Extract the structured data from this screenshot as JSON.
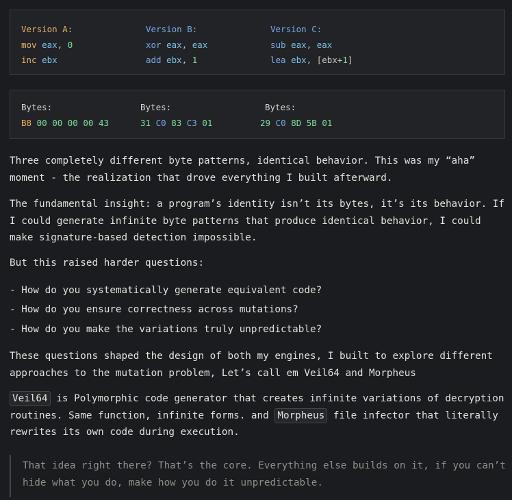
{
  "code_block_versions": {
    "version_a": {
      "header": "Version A:",
      "line1": {
        "op": "mov",
        "reg": "eax",
        "sep": ",",
        "val": "0"
      },
      "line2": {
        "op": "inc",
        "reg": "ebx"
      }
    },
    "version_b": {
      "header": "Version B:",
      "line1": {
        "op": "xor",
        "reg": "eax",
        "sep": ",",
        "val": "eax"
      },
      "line2": {
        "op": "add",
        "reg": "ebx",
        "sep": ",",
        "val": "1"
      }
    },
    "version_c": {
      "header": "Version C:",
      "line1": {
        "op": "sub",
        "reg": "eax",
        "sep": ",",
        "val": "eax"
      },
      "line2": {
        "op": "lea",
        "reg": "ebx",
        "sep": ",",
        "val_open": "[ebx",
        "val_plus": "+",
        "val_num": "1",
        "val_close": "]"
      }
    }
  },
  "code_block_bytes": {
    "col_a": {
      "label": "Bytes:",
      "bytes": [
        "B8",
        "00",
        "00",
        "00",
        "00",
        "43"
      ]
    },
    "col_b": {
      "label": "Bytes:",
      "bytes": [
        "31",
        "C0",
        "83",
        "C3",
        "01"
      ]
    },
    "col_c": {
      "label": "Bytes:",
      "bytes": [
        "29",
        "C0",
        "8D",
        "5B",
        "01"
      ]
    }
  },
  "paragraphs": {
    "p1": "Three completely different byte patterns, identical behavior. This was my “aha” moment - the realization that drove everything I built afterward.",
    "p2": "The fundamental insight: a program’s identity isn’t its bytes, it’s its behavior. If I could generate infinite byte patterns that produce identical behavior, I could make signature-based detection impossible.",
    "p3": "But this raised harder questions:",
    "p4": "These questions shaped the design of both my engines, I built to explore different approaches to the mutation problem, Let’s call em Veil64 and Morpheus"
  },
  "list_items": [
    "- How do you systematically generate equivalent code?",
    "- How do you ensure correctness across mutations?",
    "- How do you make the variations truly unpredictable?"
  ],
  "p5": {
    "code1": "Veil64",
    "text1": " is Polymorphic code generator that creates infinite variations of decryption routines. Same function, infinite forms. and ",
    "code2": "Morpheus",
    "text2": " file infector that literally rewrites its own code during execution."
  },
  "blockquote": "That idea right there? That’s the core. Everything else builds on it, if you can’t hide what you do, make how you do it unpredictable.",
  "colors": {
    "background": "#1b1c1f",
    "code_bg": "#222327",
    "orange": "#e6b06b",
    "blue": "#7aa9e6",
    "green": "#7ee0a0",
    "quote_text": "#8e8f8a"
  }
}
